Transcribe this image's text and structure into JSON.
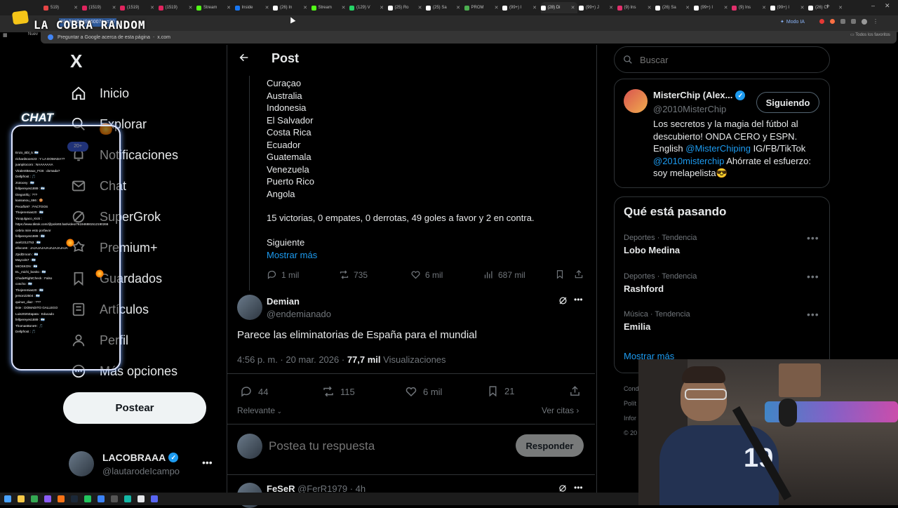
{
  "browser": {
    "tabs": [
      {
        "label": "519)",
        "color": "#e64545"
      },
      {
        "label": "(1519)",
        "color": "#e0245e"
      },
      {
        "label": "(1519)",
        "color": "#e0245e"
      },
      {
        "label": "(1519)",
        "color": "#e0245e"
      },
      {
        "label": "Stream",
        "color": "#53fc18"
      },
      {
        "label": "Inside",
        "color": "#1877f2"
      },
      {
        "label": "(26) In",
        "color": "#ffffff"
      },
      {
        "label": "Stream",
        "color": "#53fc18"
      },
      {
        "label": "(129) V",
        "color": "#25d366"
      },
      {
        "label": "(25) Ro",
        "color": "#ffffff"
      },
      {
        "label": "(25) Sa",
        "color": "#ffffff"
      },
      {
        "label": "PROM",
        "color": "#4caf50"
      },
      {
        "label": "(99+) I",
        "color": "#ffffff"
      },
      {
        "label": "(28) Di",
        "color": "#ffffff"
      },
      {
        "label": "(99+) J",
        "color": "#ffffff"
      },
      {
        "label": "(9) Ins",
        "color": "#e1306c"
      },
      {
        "label": "(26) Sa",
        "color": "#ffffff"
      },
      {
        "label": "(99+) I",
        "color": "#ffffff"
      },
      {
        "label": "(9) Ins",
        "color": "#e1306c"
      },
      {
        "label": "(99+) I",
        "color": "#ffffff"
      },
      {
        "label": "(26) Cl",
        "color": "#ffffff"
      }
    ],
    "active_tab_index": 13,
    "url_text": "0313690049760071s=20",
    "suggestion_text": "Preguntar a Google acerca de esta página",
    "suggestion_domain": "x.com",
    "ai_mode_label": "Modo IA",
    "bookmarks_label": "Todos los favoritos",
    "bookmark_left": "Nuev"
  },
  "overlay": {
    "brand": "LA COBRA RANDOM",
    "chat_title": "CHAT",
    "chat_count": "20+",
    "chat_lines": [
      "Enzo_Bbl_5: 🇦🇷",
      "richardsoom23 : Y LA DOMADA??",
      "juanpitocoro : NAAAAAAA",
      "ViralentBeaux_FCB : domada?",
      "Dellpfrost : 🎵",
      "ztotoony : 🇦🇷",
      "fellpereyes1889 : 🇦🇷",
      "Diego4Ifq : ???",
      "kassanou_666 : 🍪",
      "Pecaflo97 : FACTOOS",
      "Thejeremias20 : 🇦🇷",
      "Yooqulgaco_Kick :",
      "https://www.tiktok.com/@polo93.bat/video/761946881512190266",
      "cebrix mire esto porfavor",
      "fellpereyes1889 : 🇦🇷",
      "axel1012753 : 🇦🇷",
      "ellocon6 : JAJAJAJAJAJAJAJAJAJA",
      "ZpidDroom : 🇦🇷",
      "Maycols7 : 🇦🇷",
      "MIOSKON : 🇦🇷",
      "EL_michi_bonito : 🇦🇷",
      "ChudeRightCheck : Falso",
      "coscho : 🇦🇷",
      "Thejeremias20 : 🇦🇷",
      "jerson22504 : 🇦🇷",
      "quinus_diaz : ???",
      "tiste : DOMADITO GALLEGO",
      "Luis2020Zapata : Educado",
      "fellpereyes1889 : 🇦🇷",
      "ThomasBone9 : 🎵",
      "Dellpfrost : 🎵"
    ]
  },
  "sidebar": {
    "logo": "X",
    "items": [
      {
        "label": "Inicio",
        "icon": "home-icon"
      },
      {
        "label": "Explorar",
        "icon": "search-icon"
      },
      {
        "label": "Notificaciones",
        "icon": "bell-icon"
      },
      {
        "label": "Chat",
        "icon": "mail-icon"
      },
      {
        "label": "SuperGrok",
        "icon": "grok-icon"
      },
      {
        "label": "Premium+",
        "icon": "premium-icon"
      },
      {
        "label": "Guardados",
        "icon": "bookmark-icon"
      },
      {
        "label": "Artículos",
        "icon": "article-icon"
      },
      {
        "label": "Perfil",
        "icon": "profile-icon"
      },
      {
        "label": "Más opciones",
        "icon": "more-circle-icon"
      }
    ],
    "post_button": "Postear",
    "account": {
      "name": "LACOBRAAA",
      "handle": "@lautarodeIcampo"
    }
  },
  "main": {
    "header_title": "Post",
    "countries": [
      "Curaçao",
      "Australia",
      "Indonesia",
      "El Salvador",
      "Costa Rica",
      "Ecuador",
      "Guatemala",
      "Venezuela",
      "Puerto Rico",
      "Angola"
    ],
    "stats_line": "15 victorias, 0 empates, 0 derrotas, 49 goles a favor y 2 en contra.",
    "siguiente": "Siguiente",
    "show_more": "Mostrar más",
    "quoted_actions": {
      "replies": "1 mil",
      "reposts": "735",
      "likes": "6 mil",
      "views": "687 mil"
    },
    "tweet": {
      "name": "Demian",
      "handle": "@endemianado",
      "text": "Parece las eliminatorias de España para el mundial",
      "time": "4:56 p. m. · 20 mar. 2026 ·",
      "views_count": "77,7 mil",
      "views_label": "Visualizaciones",
      "replies": "44",
      "reposts": "115",
      "likes": "6 mil",
      "bookmarks": "21"
    },
    "sort_label": "Relevante",
    "quotes_link": "Ver citas",
    "reply_placeholder": "Postea tu respuesta",
    "reply_button": "Responder",
    "next_reply": {
      "name": "FeSeR",
      "handle": "@FerR1979",
      "time": "· 4h"
    }
  },
  "right": {
    "search_placeholder": "Buscar",
    "profile_card": {
      "name": "MisterChip (Alex...",
      "handle": "@2010MisterChip",
      "follow_button": "Siguiendo",
      "bio_1": "Los secretos y la magia del fútbol al descubierto! ONDA CERO y ESPN. English",
      "bio_link_1": "@MisterChiping",
      "bio_2": "IG/FB/TikTok",
      "bio_link_2": "@2010misterchip",
      "bio_3": "Ahórrate el esfuerzo: soy melapelista😎"
    },
    "trends_title": "Qué está pasando",
    "trends": [
      {
        "meta": "Deportes · Tendencia",
        "name": "Lobo Medina"
      },
      {
        "meta": "Deportes · Tendencia",
        "name": "Rashford"
      },
      {
        "meta": "Música · Tendencia",
        "name": "Emilia"
      }
    ],
    "trends_more": "Mostrar más",
    "footer_fragments": [
      "Cond",
      "Polít",
      "Infor",
      "© 20"
    ]
  },
  "taskbar_icons": [
    {
      "name": "windows-start-icon",
      "color": "#4aa3ff"
    },
    {
      "name": "file-explorer-icon",
      "color": "#f7c948"
    },
    {
      "name": "chrome-icon",
      "color": "#34a853"
    },
    {
      "name": "app-purple-icon",
      "color": "#8b5cf6"
    },
    {
      "name": "app-orange-icon",
      "color": "#f97316"
    },
    {
      "name": "steam-icon",
      "color": "#1b2838"
    },
    {
      "name": "app-green-icon",
      "color": "#22c55e"
    },
    {
      "name": "app-blue-icon",
      "color": "#3b82f6"
    },
    {
      "name": "obs-icon",
      "color": "#555555"
    },
    {
      "name": "app-teal-icon",
      "color": "#14b8a6"
    },
    {
      "name": "app-white-icon",
      "color": "#e5e7eb"
    },
    {
      "name": "discord-icon",
      "color": "#5865f2"
    }
  ],
  "colors": {
    "accent": "#1d9bf0",
    "verified": "#1d9bf0",
    "muted": "#71767b",
    "text": "#e7e9ea"
  }
}
